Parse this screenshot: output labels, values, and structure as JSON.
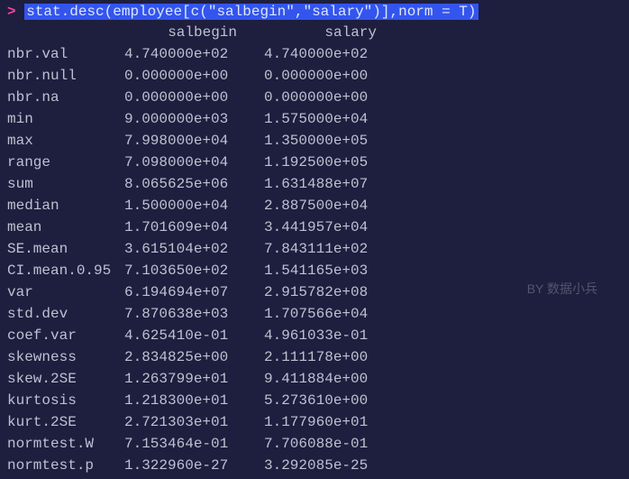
{
  "prompt": {
    "char": ">",
    "command": "stat.desc(employee[c(\"salbegin\",\"salary\")],norm = T)"
  },
  "headers": {
    "label": "",
    "col1": "salbegin",
    "col2": "salary"
  },
  "rows": [
    {
      "label": "nbr.val",
      "c1": "4.740000e+02",
      "c2": "4.740000e+02"
    },
    {
      "label": "nbr.null",
      "c1": "0.000000e+00",
      "c2": "0.000000e+00"
    },
    {
      "label": "nbr.na",
      "c1": "0.000000e+00",
      "c2": "0.000000e+00"
    },
    {
      "label": "min",
      "c1": "9.000000e+03",
      "c2": "1.575000e+04"
    },
    {
      "label": "max",
      "c1": "7.998000e+04",
      "c2": "1.350000e+05"
    },
    {
      "label": "range",
      "c1": "7.098000e+04",
      "c2": "1.192500e+05"
    },
    {
      "label": "sum",
      "c1": "8.065625e+06",
      "c2": "1.631488e+07"
    },
    {
      "label": "median",
      "c1": "1.500000e+04",
      "c2": "2.887500e+04"
    },
    {
      "label": "mean",
      "c1": "1.701609e+04",
      "c2": "3.441957e+04"
    },
    {
      "label": "SE.mean",
      "c1": "3.615104e+02",
      "c2": "7.843111e+02"
    },
    {
      "label": "CI.mean.0.95",
      "c1": "7.103650e+02",
      "c2": "1.541165e+03"
    },
    {
      "label": "var",
      "c1": "6.194694e+07",
      "c2": "2.915782e+08"
    },
    {
      "label": "std.dev",
      "c1": "7.870638e+03",
      "c2": "1.707566e+04"
    },
    {
      "label": "coef.var",
      "c1": "4.625410e-01",
      "c2": "4.961033e-01"
    },
    {
      "label": "skewness",
      "c1": "2.834825e+00",
      "c2": "2.111178e+00"
    },
    {
      "label": "skew.2SE",
      "c1": "1.263799e+01",
      "c2": "9.411884e+00"
    },
    {
      "label": "kurtosis",
      "c1": "1.218300e+01",
      "c2": "5.273610e+00"
    },
    {
      "label": "kurt.2SE",
      "c1": "2.721303e+01",
      "c2": "1.177960e+01"
    },
    {
      "label": "normtest.W",
      "c1": "7.153464e-01",
      "c2": "7.706088e-01"
    },
    {
      "label": "normtest.p",
      "c1": "1.322960e-27",
      "c2": "3.292085e-25"
    }
  ],
  "watermark": "BY 数据小兵"
}
